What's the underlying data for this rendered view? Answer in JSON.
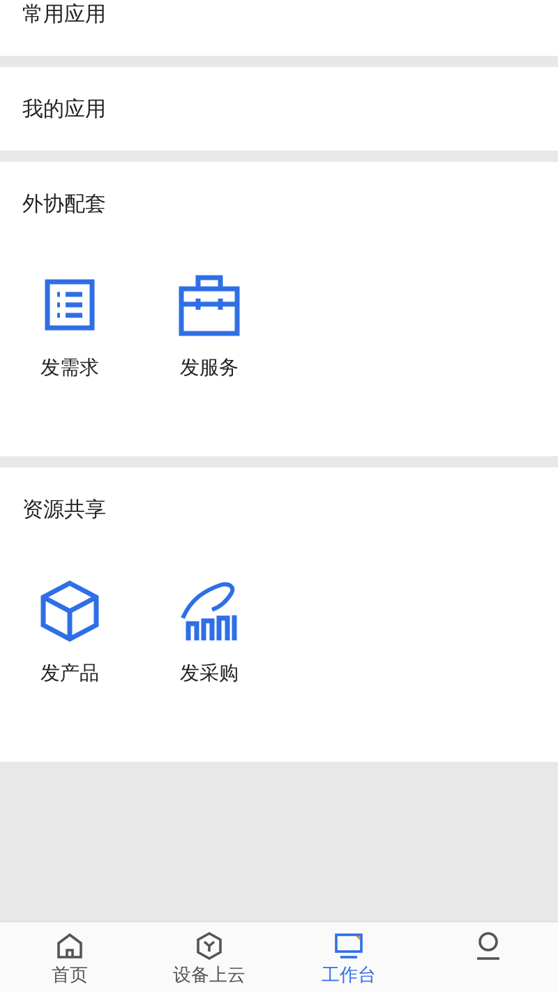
{
  "sections": [
    {
      "title": "常用应用"
    },
    {
      "title": "我的应用"
    },
    {
      "title": "外协配套",
      "items": [
        {
          "label": "发需求",
          "kind": "list"
        },
        {
          "label": "发服务",
          "kind": "toolbox"
        }
      ]
    },
    {
      "title": "资源共享",
      "items": [
        {
          "label": "发产品",
          "kind": "box"
        },
        {
          "label": "发采购",
          "kind": "purchase"
        }
      ]
    }
  ],
  "tab_bar": [
    {
      "label": "首页",
      "kind": "home",
      "selected": false
    },
    {
      "label": "设备上云",
      "kind": "device",
      "selected": false
    },
    {
      "label": "工作台",
      "kind": "desk",
      "selected": true
    },
    {
      "kind": "profile",
      "selected": false
    }
  ]
}
